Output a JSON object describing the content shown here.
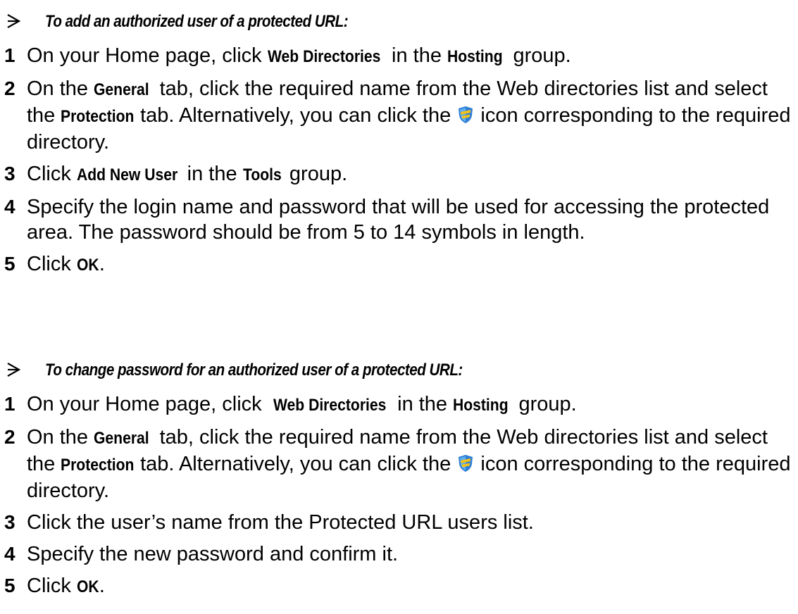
{
  "procedures": [
    {
      "title": "To add an authorized user of a protected URL:",
      "steps": [
        {
          "num": "1",
          "parts": [
            {
              "t": "On your Home page, click "
            },
            {
              "t": "Web Directories",
              "b": true
            },
            {
              "t": " in the "
            },
            {
              "t": "Hosting",
              "b": true
            },
            {
              "t": " group."
            }
          ]
        },
        {
          "num": "2",
          "parts": [
            {
              "t": "On the "
            },
            {
              "t": "General",
              "b": true
            },
            {
              "t": " tab, click the required name from the Web directories list and select the "
            },
            {
              "t": "Protection",
              "b": true
            },
            {
              "t": " tab. Alternatively, you can click the "
            },
            {
              "icon": "shield-icon"
            },
            {
              "t": " icon corresponding to the required directory."
            }
          ]
        },
        {
          "num": "3",
          "parts": [
            {
              "t": "Click "
            },
            {
              "t": "Add New User",
              "b": true
            },
            {
              "t": " in the "
            },
            {
              "t": "Tools",
              "b": true
            },
            {
              "t": " group."
            }
          ]
        },
        {
          "num": "4",
          "parts": [
            {
              "t": "Specify the login name and password that will be used for accessing the protected area. The password should be from 5 to 14 symbols in length."
            }
          ]
        },
        {
          "num": "5",
          "parts": [
            {
              "t": "Click "
            },
            {
              "t": "OK",
              "b": true
            },
            {
              "t": "."
            }
          ]
        }
      ]
    },
    {
      "title": "To change password for an authorized user of a protected URL:",
      "steps": [
        {
          "num": "1",
          "parts": [
            {
              "t": "On your Home page, click  "
            },
            {
              "t": "Web Directories",
              "b": true
            },
            {
              "t": " in the "
            },
            {
              "t": "Hosting",
              "b": true
            },
            {
              "t": " group."
            }
          ]
        },
        {
          "num": "2",
          "parts": [
            {
              "t": "On the "
            },
            {
              "t": "General",
              "b": true
            },
            {
              "t": " tab, click the required name from the Web directories list and select the "
            },
            {
              "t": "Protection",
              "b": true
            },
            {
              "t": " tab. Alternatively, you can click the "
            },
            {
              "icon": "shield-icon"
            },
            {
              "t": " icon corresponding to the required directory."
            }
          ]
        },
        {
          "num": "3",
          "parts": [
            {
              "t": "Click the user’s name from the Protected URL users list."
            }
          ]
        },
        {
          "num": "4",
          "parts": [
            {
              "t": "Specify the new password and confirm it."
            }
          ]
        },
        {
          "num": "5",
          "parts": [
            {
              "t": "Click "
            },
            {
              "t": "OK",
              "b": true
            },
            {
              "t": "."
            }
          ]
        }
      ]
    }
  ],
  "icons": {
    "procedure_marker": "arrow-right-icon",
    "protection": "shield-icon"
  },
  "colors": {
    "text": "#000000",
    "background": "#ffffff",
    "shield_blue": "#2f7fd6",
    "shield_yellow": "#f2c21a"
  }
}
